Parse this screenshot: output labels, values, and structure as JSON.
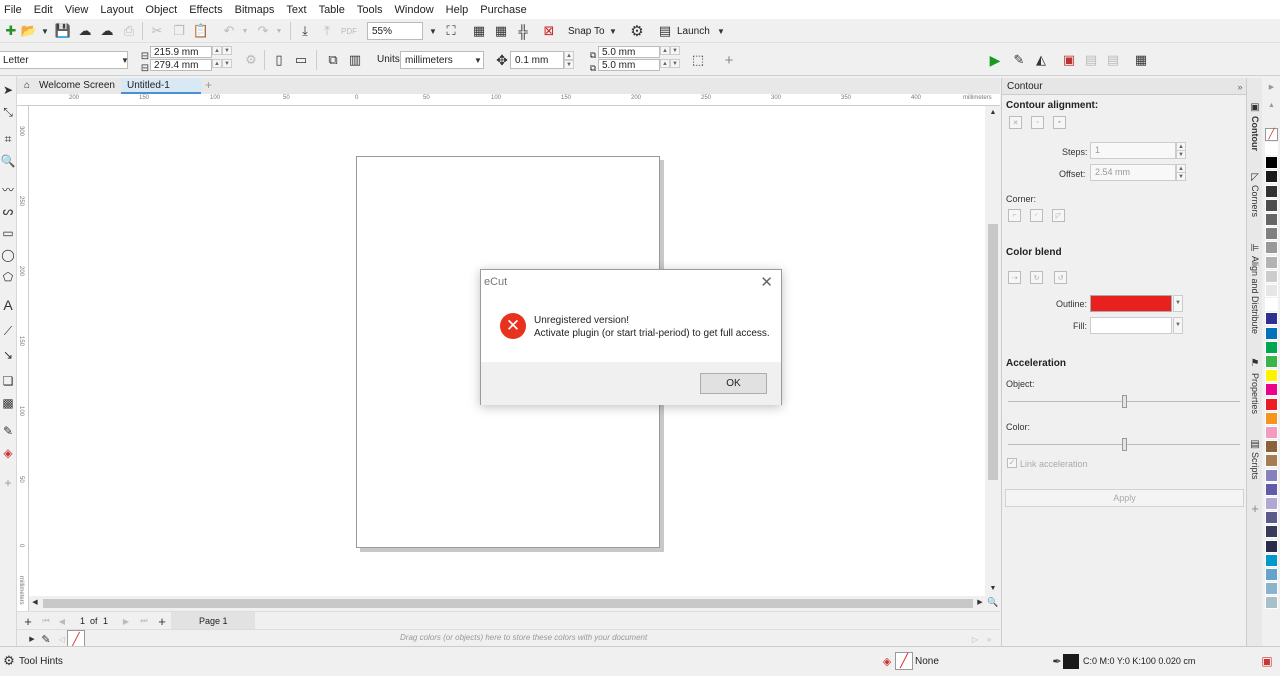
{
  "menu": [
    "File",
    "Edit",
    "View",
    "Layout",
    "Object",
    "Effects",
    "Bitmaps",
    "Text",
    "Table",
    "Tools",
    "Window",
    "Help",
    "Purchase"
  ],
  "toolbar1": {
    "zoom": "55%",
    "snap_label": "Snap To",
    "launch_label": "Launch"
  },
  "toolbar2": {
    "page_size": "Letter",
    "width": "215.9 mm",
    "height": "279.4 mm",
    "units_label": "Units:",
    "units_value": "millimeters",
    "nudge": "0.1 mm",
    "dup_x": "5.0 mm",
    "dup_y": "5.0 mm"
  },
  "tabs": {
    "welcome": "Welcome Screen",
    "document": "Untitled-1"
  },
  "ruler": {
    "h_ticks": [
      "200",
      "150",
      "100",
      "50",
      "0",
      "50",
      "100",
      "150",
      "200",
      "250",
      "300",
      "350",
      "400"
    ],
    "h_unit": "millimeters",
    "v_ticks": [
      "300",
      "250",
      "200",
      "150",
      "100",
      "50",
      "0"
    ],
    "v_unit": "millimeters"
  },
  "pagenav": {
    "counter": "1",
    "of_label": "of",
    "total": "1",
    "page_tab": "Page 1"
  },
  "docpalette": {
    "hint": "Drag colors (or objects) here to store these colors with your document"
  },
  "status": {
    "tool_hints": "Tool Hints",
    "fill_label": "None",
    "outline_info": "C:0 M:0 Y:0 K:100  0.020 cm"
  },
  "docker": {
    "title": "Contour",
    "alignment_heading": "Contour alignment:",
    "steps_label": "Steps:",
    "steps_value": "1",
    "offset_label": "Offset:",
    "offset_value": "2.54 mm",
    "corner_label": "Corner:",
    "blend_heading": "Color blend",
    "outline_label": "Outline:",
    "fill_label": "Fill:",
    "outline_color": "#e8211f",
    "accel_heading": "Acceleration",
    "object_label": "Object:",
    "color_label": "Color:",
    "link_accel": "Link acceleration",
    "apply": "Apply"
  },
  "sidetabs": [
    "Contour",
    "Corners",
    "Align and Distribute",
    "Properties",
    "Scripts"
  ],
  "palette": [
    "#ffffff",
    "#000000",
    "#1a1a1a",
    "#333333",
    "#4d4d4d",
    "#666666",
    "#808080",
    "#999999",
    "#b3b3b3",
    "#cccccc",
    "#e6e6e6",
    "#ffffff",
    "#2e3192",
    "#0072bc",
    "#00a651",
    "#39b54a",
    "#fff200",
    "#ec008c",
    "#ed1c24",
    "#f7941d",
    "#f49ac1",
    "#8c6239",
    "#a67c52",
    "#8781bd",
    "#605ca8",
    "#b2a6d4",
    "#5b5a8a",
    "#3a3a5c",
    "#2b2b4a",
    "#0099cc",
    "#66a3cc",
    "#8ab4cc",
    "#a8c0cc"
  ],
  "dialog": {
    "title": "eCut",
    "line1": "Unregistered version!",
    "line2": "Activate plugin (or start trial-period) to get full access.",
    "ok": "OK"
  }
}
